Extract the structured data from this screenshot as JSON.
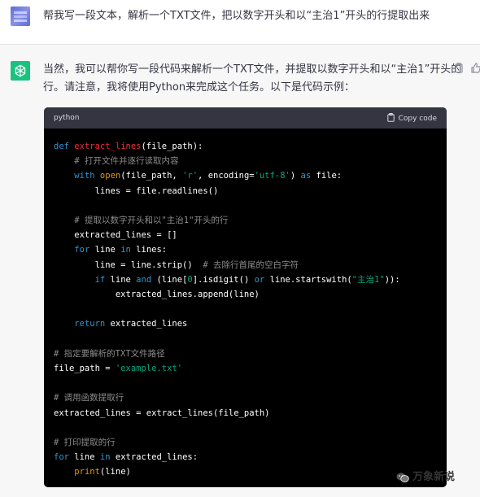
{
  "user_message": "帮我写一段文本，解析一个TXT文件，把以数字开头和以“主治1”开头的行提取出来",
  "assistant_message": {
    "line1": "当然，我可以帮你写一段代码来解析一个TXT文件，并提取以数字开头和以“主治1”开头的",
    "line2": "行。请注意，我将使用Python来完成这个任务。以下是代码示例："
  },
  "code_block": {
    "language": "python",
    "copy_label": "Copy code",
    "code": [
      [
        [
          "kw",
          "def"
        ],
        [
          "t",
          " "
        ],
        [
          "fn",
          "extract_lines"
        ],
        [
          "t",
          "(file_path):"
        ]
      ],
      [
        [
          "t",
          "    "
        ],
        [
          "cm",
          "# 打开文件并逐行读取内容"
        ]
      ],
      [
        [
          "t",
          "    "
        ],
        [
          "kw",
          "with"
        ],
        [
          "t",
          " "
        ],
        [
          "bi",
          "open"
        ],
        [
          "t",
          "(file_path, "
        ],
        [
          "st",
          "'r'"
        ],
        [
          "t",
          ", encoding="
        ],
        [
          "st",
          "'utf-8'"
        ],
        [
          "t",
          ") "
        ],
        [
          "kw",
          "as"
        ],
        [
          "t",
          " file:"
        ]
      ],
      [
        [
          "t",
          "        lines = file.readlines()"
        ]
      ],
      [],
      [
        [
          "t",
          "    "
        ],
        [
          "cm",
          "# 提取以数字开头和以\"主治1\"开头的行"
        ]
      ],
      [
        [
          "t",
          "    extracted_lines = []"
        ]
      ],
      [
        [
          "t",
          "    "
        ],
        [
          "kw",
          "for"
        ],
        [
          "t",
          " line "
        ],
        [
          "kw",
          "in"
        ],
        [
          "t",
          " lines:"
        ]
      ],
      [
        [
          "t",
          "        line = line.strip()  "
        ],
        [
          "cm",
          "# 去除行首尾的空白字符"
        ]
      ],
      [
        [
          "t",
          "        "
        ],
        [
          "kw",
          "if"
        ],
        [
          "t",
          " line "
        ],
        [
          "kw",
          "and"
        ],
        [
          "t",
          " (line["
        ],
        [
          "st",
          "0"
        ],
        [
          "t",
          "].isdigit() "
        ],
        [
          "kw",
          "or"
        ],
        [
          "t",
          " line.startswith("
        ],
        [
          "st",
          "\"主治1\""
        ],
        [
          "t",
          ")):"
        ]
      ],
      [
        [
          "t",
          "            extracted_lines.append(line)"
        ]
      ],
      [],
      [
        [
          "t",
          "    "
        ],
        [
          "kw",
          "return"
        ],
        [
          "t",
          " extracted_lines"
        ]
      ],
      [],
      [
        [
          "cm",
          "# 指定要解析的TXT文件路径"
        ]
      ],
      [
        [
          "t",
          "file_path = "
        ],
        [
          "st",
          "'example.txt'"
        ]
      ],
      [],
      [
        [
          "cm",
          "# 调用函数提取行"
        ]
      ],
      [
        [
          "t",
          "extracted_lines = extract_lines(file_path)"
        ]
      ],
      [],
      [
        [
          "cm",
          "# 打印提取的行"
        ]
      ],
      [
        [
          "kw",
          "for"
        ],
        [
          "t",
          " line "
        ],
        [
          "kw",
          "in"
        ],
        [
          "t",
          " extracted_lines:"
        ]
      ],
      [
        [
          "t",
          "    "
        ],
        [
          "bi",
          "print"
        ],
        [
          "t",
          "(line)"
        ]
      ]
    ]
  },
  "watermark": "万象新说",
  "icons": {
    "copy": "clipboard-icon",
    "thumbs_up": "thumbs-up-icon",
    "bot": "openai-logo-icon",
    "watermark": "wechat-icon"
  },
  "colors": {
    "bot_avatar": "#19c37d",
    "code_bg": "#000000",
    "code_header_bg": "#343541",
    "keyword": "#2e95d3",
    "function": "#f22c3d",
    "builtin": "#e9950c",
    "string": "#00a67d",
    "comment": "#8c8c8c"
  }
}
